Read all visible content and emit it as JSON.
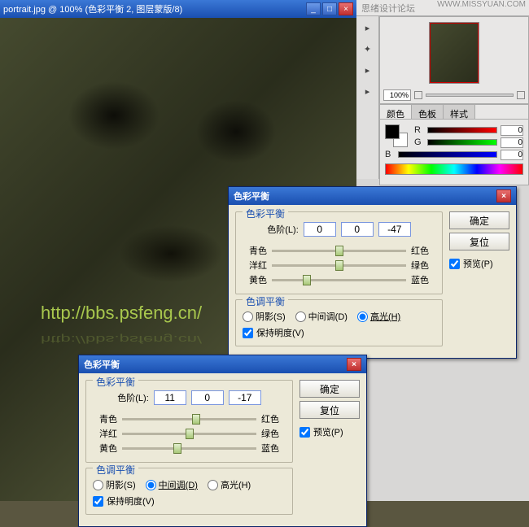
{
  "doc": {
    "title": "portrait.jpg @ 100% (色彩平衡 2, 图层蒙版/8)",
    "watermark": "http://bbs.psfeng.cn/"
  },
  "top_toolbar": {
    "label": "思绪设计论坛",
    "site": "WWW.MISSYUAN.COM"
  },
  "nav": {
    "zoom": "100%"
  },
  "color_panel": {
    "tabs": [
      "颜色",
      "色板",
      "样式"
    ],
    "r": 0,
    "g": 0,
    "b": 0
  },
  "dialog1": {
    "title": "色彩平衡",
    "group1": "色彩平衡",
    "levels_label": "色阶(L):",
    "levels": [
      0,
      0,
      -47
    ],
    "sliders": [
      {
        "l": "青色",
        "r": "红色",
        "pos": 50
      },
      {
        "l": "洋红",
        "r": "绿色",
        "pos": 50
      },
      {
        "l": "黄色",
        "r": "蓝色",
        "pos": 26
      }
    ],
    "group2": "色调平衡",
    "radios": {
      "shadows": "阴影(S)",
      "mid": "中间调(D)",
      "high": "高光(H)",
      "selected": "high"
    },
    "keep": "保持明度(V)",
    "btn_ok": "确定",
    "btn_reset": "复位",
    "preview": "预览(P)"
  },
  "dialog2": {
    "title": "色彩平衡",
    "group1": "色彩平衡",
    "levels_label": "色阶(L):",
    "levels": [
      11,
      0,
      -17
    ],
    "sliders": [
      {
        "l": "青色",
        "r": "红色",
        "pos": 55
      },
      {
        "l": "洋红",
        "r": "绿色",
        "pos": 50
      },
      {
        "l": "黄色",
        "r": "蓝色",
        "pos": 41
      }
    ],
    "group2": "色调平衡",
    "radios": {
      "shadows": "阴影(S)",
      "mid": "中间调(D)",
      "high": "高光(H)",
      "selected": "mid"
    },
    "keep": "保持明度(V)",
    "btn_ok": "确定",
    "btn_reset": "复位",
    "preview": "预览(P)"
  }
}
